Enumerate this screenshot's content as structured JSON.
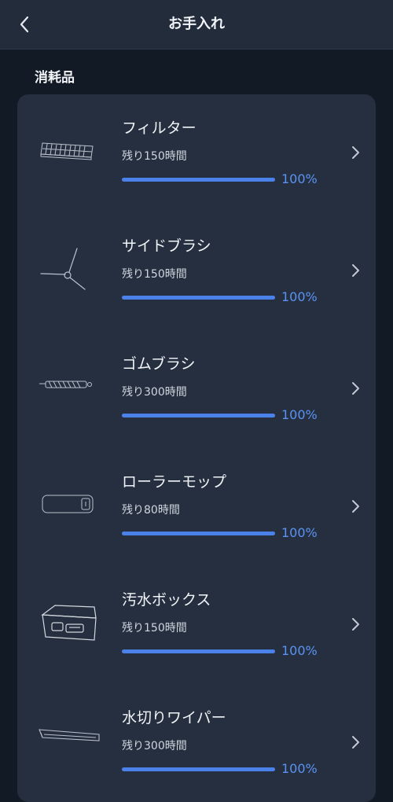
{
  "header": {
    "title": "お手入れ"
  },
  "section": {
    "title": "消耗品"
  },
  "colors": {
    "accent": "#4b82ea",
    "background": "#121a25",
    "card": "#252f3f"
  },
  "items": [
    {
      "name": "フィルター",
      "remaining": "残り150時間",
      "percent_label": "100%",
      "percent": 100,
      "icon": "filter-icon"
    },
    {
      "name": "サイドブラシ",
      "remaining": "残り150時間",
      "percent_label": "100%",
      "percent": 100,
      "icon": "side-brush-icon"
    },
    {
      "name": "ゴムブラシ",
      "remaining": "残り300時間",
      "percent_label": "100%",
      "percent": 100,
      "icon": "rubber-brush-icon"
    },
    {
      "name": "ローラーモップ",
      "remaining": "残り80時間",
      "percent_label": "100%",
      "percent": 100,
      "icon": "roller-mop-icon"
    },
    {
      "name": "汚水ボックス",
      "remaining": "残り150時間",
      "percent_label": "100%",
      "percent": 100,
      "icon": "dirty-water-box-icon"
    },
    {
      "name": "水切りワイパー",
      "remaining": "残り300時間",
      "percent_label": "100%",
      "percent": 100,
      "icon": "squeegee-wiper-icon"
    }
  ]
}
